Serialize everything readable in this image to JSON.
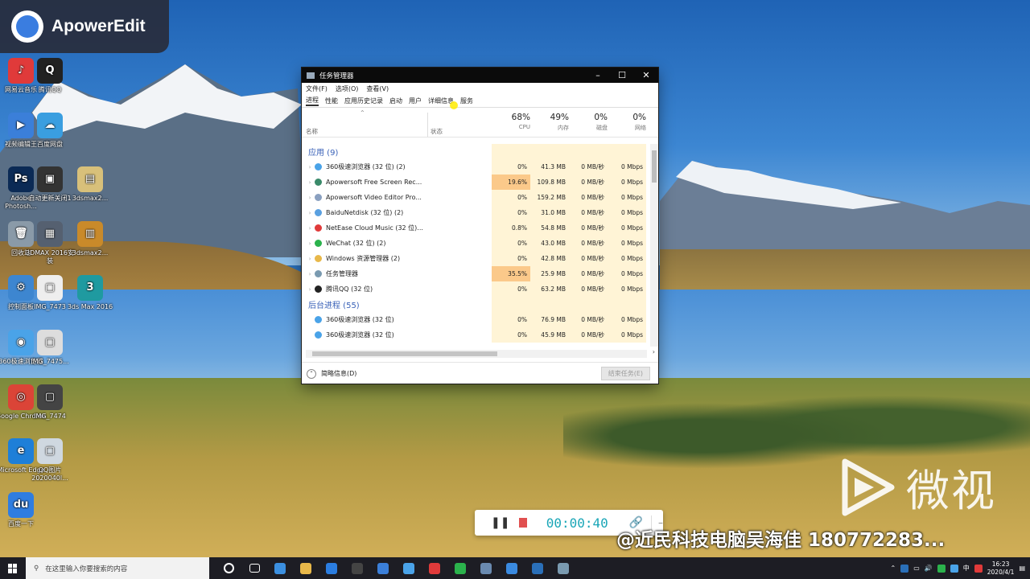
{
  "app_badge": {
    "name": "ApowerEdit"
  },
  "desktop_icons": [
    {
      "label": "网易云音乐",
      "color": "#e03a3a",
      "glyph": "♪"
    },
    {
      "label": "腾讯QQ",
      "color": "#222222",
      "glyph": "Q"
    },
    {
      "label": "视频编辑王",
      "color": "#3b7fd9",
      "glyph": "▶"
    },
    {
      "label": "百度网盘",
      "color": "#3a9ee0",
      "glyph": "☁"
    },
    {
      "label": "Adobe Photosh...",
      "color": "#0b2a55",
      "glyph": "Ps"
    },
    {
      "label": "自动更新关闭1",
      "color": "#333333",
      "glyph": "▣"
    },
    {
      "label": "3dsmax2...",
      "color": "#d8c07a",
      "glyph": "▤"
    },
    {
      "label": "回收站",
      "color": "#8a9aa8",
      "glyph": "🗑"
    },
    {
      "label": "3DMAX 2016安装",
      "color": "#556070",
      "glyph": "▦"
    },
    {
      "label": "3dsmax2...",
      "color": "#c98a2a",
      "glyph": "▥"
    },
    {
      "label": "控制面板",
      "color": "#3d86d0",
      "glyph": "⚙"
    },
    {
      "label": "IMG_7473",
      "color": "#eeeeee",
      "glyph": "▢"
    },
    {
      "label": "3ds Max 2016",
      "color": "#1f9aa0",
      "glyph": "3"
    },
    {
      "label": "360极速浏览器",
      "color": "#4aa3e8",
      "glyph": "◉"
    },
    {
      "label": "IMG_7475...",
      "color": "#dddddd",
      "glyph": "▢"
    },
    {
      "label": "Google Chrome",
      "color": "#db4437",
      "glyph": "◎"
    },
    {
      "label": "IMG_7474",
      "color": "#444444",
      "glyph": "▢"
    },
    {
      "label": "Microsoft Edge",
      "color": "#1e7fd8",
      "glyph": "e"
    },
    {
      "label": "QQ图片2020040l...",
      "color": "#cfd8e0",
      "glyph": "▢"
    },
    {
      "label": "百度一下",
      "color": "#2f7de0",
      "glyph": "du"
    }
  ],
  "task_manager": {
    "title": "任务管理器",
    "menu": [
      "文件(F)",
      "选项(O)",
      "查看(V)"
    ],
    "tabs": [
      "进程",
      "性能",
      "应用历史记录",
      "启动",
      "用户",
      "详细信息",
      "服务"
    ],
    "columns": {
      "name": "名称",
      "status": "状态",
      "cpu": {
        "pct": "68%",
        "label": "CPU"
      },
      "mem": {
        "pct": "49%",
        "label": "内存"
      },
      "disk": {
        "pct": "0%",
        "label": "磁盘"
      },
      "net": {
        "pct": "0%",
        "label": "网络"
      }
    },
    "group_apps": "应用 (9)",
    "apps": [
      {
        "name": "360极速浏览器 (32 位) (2)",
        "cpu": "0%",
        "mem": "41.3 MB",
        "disk": "0 MB/秒",
        "net": "0 Mbps",
        "icon": "#4aa3e8",
        "hot": false
      },
      {
        "name": "Apowersoft Free Screen Rec...",
        "cpu": "19.6%",
        "mem": "109.8 MB",
        "disk": "0 MB/秒",
        "net": "0 Mbps",
        "icon": "#3a8a6a",
        "hot": true
      },
      {
        "name": "Apowersoft Video Editor Pro...",
        "cpu": "0%",
        "mem": "159.2 MB",
        "disk": "0 MB/秒",
        "net": "0 Mbps",
        "icon": "#8aa0c0",
        "hot": false
      },
      {
        "name": "BaiduNetdisk (32 位) (2)",
        "cpu": "0%",
        "mem": "31.0 MB",
        "disk": "0 MB/秒",
        "net": "0 Mbps",
        "icon": "#5aa0e0",
        "hot": false
      },
      {
        "name": "NetEase Cloud Music (32 位)...",
        "cpu": "0.8%",
        "mem": "54.8 MB",
        "disk": "0 MB/秒",
        "net": "0 Mbps",
        "icon": "#e03a3a",
        "hot": false
      },
      {
        "name": "WeChat (32 位) (2)",
        "cpu": "0%",
        "mem": "43.0 MB",
        "disk": "0 MB/秒",
        "net": "0 Mbps",
        "icon": "#2bb24c",
        "hot": false
      },
      {
        "name": "Windows 资源管理器 (2)",
        "cpu": "0%",
        "mem": "42.8 MB",
        "disk": "0 MB/秒",
        "net": "0 Mbps",
        "icon": "#e8b84a",
        "hot": false
      },
      {
        "name": "任务管理器",
        "cpu": "35.5%",
        "mem": "25.9 MB",
        "disk": "0 MB/秒",
        "net": "0 Mbps",
        "icon": "#7a9ab0",
        "hot": true
      },
      {
        "name": "腾讯QQ (32 位)",
        "cpu": "0%",
        "mem": "63.2 MB",
        "disk": "0 MB/秒",
        "net": "0 Mbps",
        "icon": "#222222",
        "hot": false
      }
    ],
    "group_bg": "后台进程 (55)",
    "bg": [
      {
        "name": "360极速浏览器 (32 位)",
        "cpu": "0%",
        "mem": "76.9 MB",
        "disk": "0 MB/秒",
        "net": "0 Mbps",
        "icon": "#4aa3e8"
      },
      {
        "name": "360极速浏览器 (32 位)",
        "cpu": "0%",
        "mem": "45.9 MB",
        "disk": "0 MB/秒",
        "net": "0 Mbps",
        "icon": "#4aa3e8"
      }
    ],
    "footer_less": "简略信息(D)",
    "footer_end": "结束任务(E)"
  },
  "recorder": {
    "time": "00:00:40"
  },
  "watermark": {
    "brand": "微视",
    "credit": "@近民科技电脑吴海佳 180772283..."
  },
  "taskbar": {
    "search_placeholder": "在这里输入你要搜索的内容",
    "apps": [
      "#3b8fe0",
      "#e8b84a",
      "#2b7de0",
      "#444444",
      "#3b7fd9",
      "#4aa3e8",
      "#e03a3a",
      "#2bb24c",
      "#6a8ab0",
      "#3a8ae0",
      "#2a6fb8",
      "#7a9ab0"
    ],
    "tray_ime": "中",
    "time": "16:23",
    "date": "2020/4/1"
  },
  "colors": {
    "cpu_hot": "#fbc98a",
    "cpu_warm": "#fff2cf",
    "col_bg": "#fff4d6",
    "group": "#3a62b8"
  }
}
